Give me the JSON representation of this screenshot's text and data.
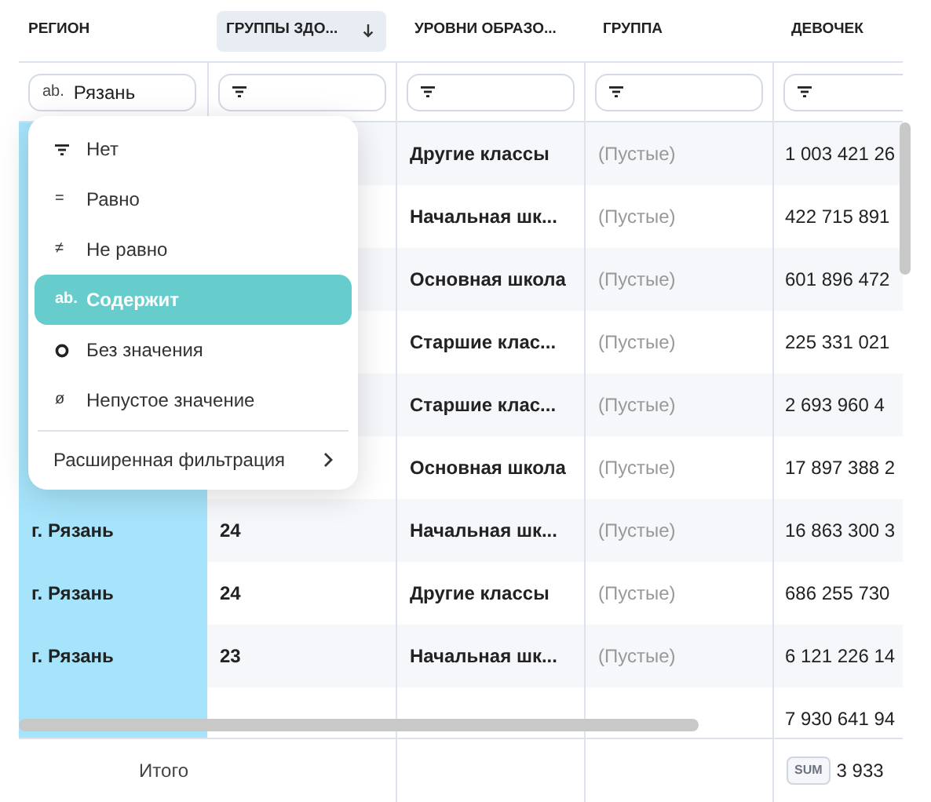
{
  "columns": [
    {
      "label": "РЕГИОН",
      "sorted": false
    },
    {
      "label": "ГРУППЫ ЗДО...",
      "sorted": true
    },
    {
      "label": "УРОВНИ ОБРАЗО...",
      "sorted": false
    },
    {
      "label": "ГРУППА",
      "sorted": false
    },
    {
      "label": "ДЕВОЧЕК",
      "sorted": false
    }
  ],
  "filters": [
    {
      "kind": "text",
      "prefix": "ab.",
      "value": "Рязань"
    },
    {
      "kind": "empty"
    },
    {
      "kind": "empty"
    },
    {
      "kind": "empty"
    },
    {
      "kind": "empty"
    }
  ],
  "rows": [
    {
      "education_level": "Другие классы",
      "group": "(Пустые)",
      "girls": "1 003 421 26"
    },
    {
      "education_level": "Начальная шк...",
      "group": "(Пустые)",
      "girls": "422 715 891"
    },
    {
      "education_level": "Основная школа",
      "group": "(Пустые)",
      "girls": "601 896 472"
    },
    {
      "education_level": "Старшие клас...",
      "group": "(Пустые)",
      "girls": "225 331 021"
    },
    {
      "education_level": "Старшие клас...",
      "group": "(Пустые)",
      "girls": "2 693 960 4"
    },
    {
      "education_level": "Основная школа",
      "group": "(Пустые)",
      "girls": "17 897 388 2"
    },
    {
      "region": "г. Рязань",
      "health_group": "24",
      "education_level": "Начальная шк...",
      "group": "(Пустые)",
      "girls": "16 863 300 3"
    },
    {
      "region": "г. Рязань",
      "health_group": "24",
      "education_level": "Другие классы",
      "group": "(Пустые)",
      "girls": "686 255 730"
    },
    {
      "region": "г. Рязань",
      "health_group": "23",
      "education_level": "Начальная шк...",
      "group": "(Пустые)",
      "girls": "6 121 226 14"
    },
    {
      "girls": "7 930 641 94"
    }
  ],
  "footer": {
    "label": "Итого",
    "badge": "SUM",
    "total": "3 933"
  },
  "filter_menu": {
    "items": [
      {
        "kind": "filter",
        "label": "Нет",
        "selected": false
      },
      {
        "kind": "glyph",
        "glyph": "=",
        "label": "Равно",
        "selected": false
      },
      {
        "kind": "glyph",
        "glyph": "≠",
        "label": "Не равно",
        "selected": false
      },
      {
        "kind": "glyph",
        "glyph": "ab.",
        "label": "Содержит",
        "selected": true
      },
      {
        "kind": "circle",
        "label": "Без значения",
        "selected": false
      },
      {
        "kind": "glyph",
        "glyph": "ø",
        "label": "Непустое значение",
        "selected": false
      }
    ],
    "advanced": "Расширенная фильтрация"
  }
}
